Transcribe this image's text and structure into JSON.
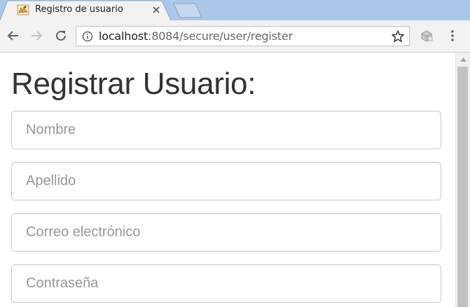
{
  "browser": {
    "tab_title": "Registro de usuario",
    "url_host": "localhost",
    "url_rest": ":8084/secure/user/register",
    "icons": [
      "tomcat-favicon",
      "close-icon",
      "back-arrow-icon",
      "forward-arrow-icon",
      "reload-icon",
      "info-icon",
      "star-icon",
      "extension-icon",
      "menu-dots-icon"
    ]
  },
  "page": {
    "title": "Registrar Usuario:",
    "fields": {
      "nombre_placeholder": "Nombre",
      "apellido_placeholder": "Apellido",
      "correo_placeholder": "Correo electrónico",
      "contrasena_placeholder": "Contraseña"
    }
  },
  "colors": {
    "tabstrip": "#aac6e8",
    "toolbar": "#f2f2f2",
    "input_border": "#cccccc",
    "placeholder": "#999999",
    "title_text": "#333333"
  }
}
